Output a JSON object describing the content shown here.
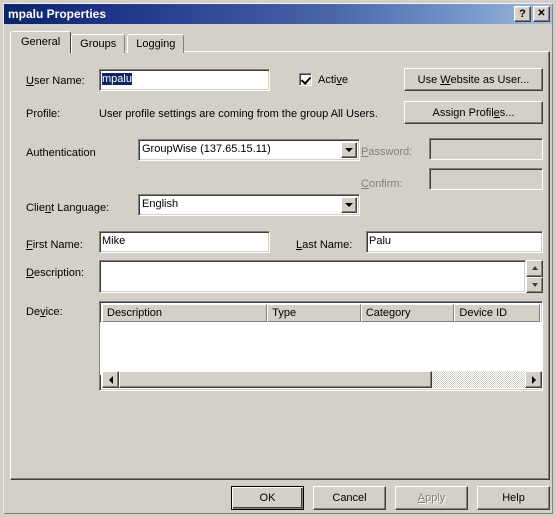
{
  "window": {
    "title": "mpalu Properties",
    "help_button": "?",
    "close_button": "✕"
  },
  "tabs": [
    {
      "label": "General",
      "selected": true
    },
    {
      "label": "Groups",
      "selected": false
    },
    {
      "label": "Logging",
      "selected": false
    }
  ],
  "general": {
    "user_name": {
      "label": "User Name:",
      "label_pre": "",
      "label_accel": "U",
      "label_post": "ser Name:",
      "value": "mpalu",
      "selected": true
    },
    "active": {
      "label_pre": "Acti",
      "label_accel": "v",
      "label_post": "e",
      "checked": true
    },
    "use_website_button": {
      "pre": "Use ",
      "accel": "W",
      "post": "ebsite as User..."
    },
    "profile": {
      "label": "Profile:",
      "text": "User profile settings are coming from the group All Users."
    },
    "assign_profiles_button": {
      "pre": "Assign Profil",
      "accel": "e",
      "post": "s..."
    },
    "authentication": {
      "label": "Authentication",
      "value": "GroupWise (137.65.15.11)"
    },
    "password": {
      "label_pre": "",
      "label_accel": "P",
      "label_post": "assword:",
      "value": "",
      "disabled": true
    },
    "confirm": {
      "label_pre": "",
      "label_accel": "C",
      "label_post": "onfirm:",
      "value": "",
      "disabled": true
    },
    "client_language": {
      "label_pre": "Clie",
      "label_accel": "n",
      "label_post": "t Language:",
      "value": "English"
    },
    "first_name": {
      "label_pre": "",
      "label_accel": "F",
      "label_post": "irst Name:",
      "value": "Mike"
    },
    "last_name": {
      "label_pre": "",
      "label_accel": "L",
      "label_post": "ast Name:",
      "value": "Palu"
    },
    "description": {
      "label_pre": "",
      "label_accel": "D",
      "label_post": "escription:",
      "value": ""
    },
    "device": {
      "label_pre": "De",
      "label_accel": "v",
      "label_post": "ice:",
      "columns": [
        "Description",
        "Type",
        "Category",
        "Device ID"
      ],
      "rows": []
    }
  },
  "footer": {
    "ok": "OK",
    "cancel": "Cancel",
    "apply": "Apply",
    "apply_pre": "",
    "apply_accel": "A",
    "apply_post": "pply",
    "help": "Help",
    "apply_disabled": true
  },
  "colors": {
    "face": "#d4d0c8",
    "title_start": "#0a246a",
    "title_end": "#a6bee0",
    "selection": "#0a246a",
    "disabled_text": "#808080"
  }
}
